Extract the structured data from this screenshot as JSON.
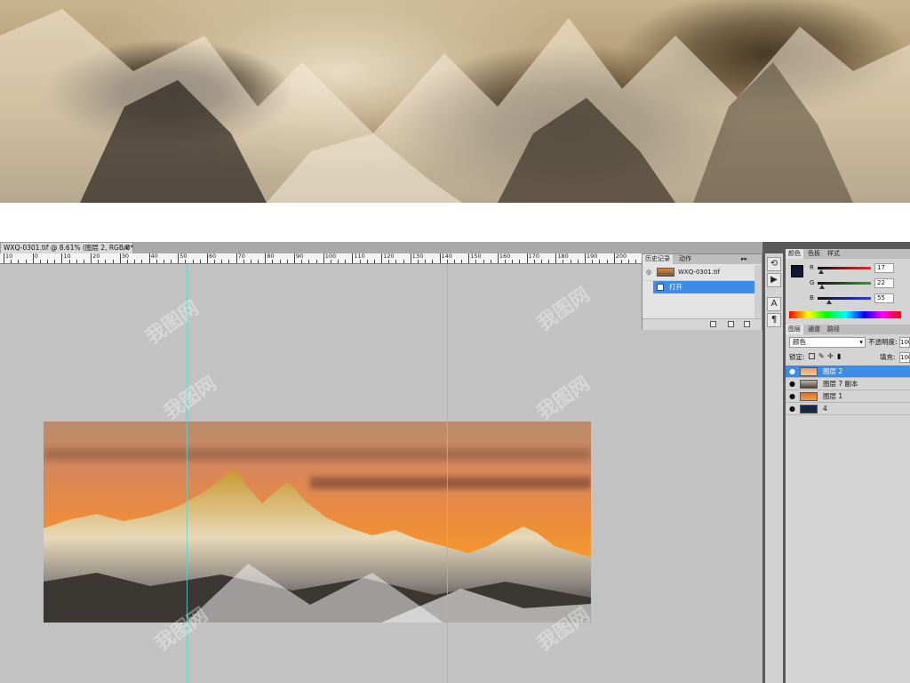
{
  "document": {
    "tab_label": "WXQ-0301.tif @ 8.61% (图层 2, RGB/8*)",
    "close_glyph": "×"
  },
  "ruler": {
    "labels": [
      "10",
      "0",
      "10",
      "20",
      "30",
      "40",
      "50",
      "60",
      "70",
      "80",
      "90",
      "100",
      "110",
      "120",
      "130",
      "140",
      "150",
      "160",
      "170",
      "180",
      "190",
      "200"
    ]
  },
  "history_panel": {
    "tabs": [
      "历史记录",
      "动作"
    ],
    "snapshot_name": "WXQ-0301.tif",
    "items": [
      "打开"
    ],
    "menu_glyph": "▸▸"
  },
  "color_panel": {
    "tabs": [
      "颜色",
      "色板",
      "样式"
    ],
    "channels": [
      {
        "label": "R",
        "value": "17",
        "color": "#e03030"
      },
      {
        "label": "G",
        "value": "22",
        "color": "#2ea02e"
      },
      {
        "label": "B",
        "value": "55",
        "color": "#2a3ad8"
      }
    ],
    "foreground_color": "#111637"
  },
  "layers_panel": {
    "tabs": [
      "图层",
      "通道",
      "路径"
    ],
    "blend_mode": "颜色",
    "opacity_label": "不透明度:",
    "opacity_value": "100",
    "lock_label": "锁定:",
    "fill_label": "填充:",
    "fill_value": "100",
    "layers": [
      {
        "name": "图层 2",
        "selected": true,
        "thumb_color": "#d98a3c"
      },
      {
        "name": "图层 7 副本",
        "selected": false,
        "thumb_color": "#9b8c78"
      },
      {
        "name": "图层 1",
        "selected": false,
        "thumb_color": "#e07a2a"
      },
      {
        "name": "4",
        "selected": false,
        "thumb_color": "#142a40"
      }
    ]
  },
  "tool_strip": {
    "tools": [
      "history-brush-icon",
      "play-icon",
      "character-icon",
      "paragraph-icon"
    ]
  },
  "watermark": {
    "text": "我图网"
  }
}
